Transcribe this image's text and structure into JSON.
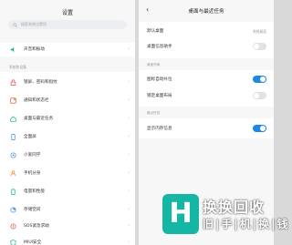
{
  "settings": {
    "title": "设置",
    "search_placeholder": "搜索系统设置项",
    "top_item": "声音和振动",
    "section_label": "系统和设备",
    "items": [
      {
        "label": "锁屏、密码和指纹",
        "icon": "lock-icon",
        "color": "#e25b4f"
      },
      {
        "label": "通知和状态栏",
        "icon": "notification-icon",
        "color": "#e55a3b"
      },
      {
        "label": "桌面与最近任务",
        "icon": "home-icon",
        "color": "#2bb673"
      },
      {
        "label": "全面屏",
        "icon": "fullscreen-icon",
        "color": "#4a90e2"
      },
      {
        "label": "小爱同学",
        "icon": "assistant-icon",
        "color": "#4a90e2"
      },
      {
        "label": "手机分身",
        "icon": "dual-user-icon",
        "color": "#f08a24"
      },
      {
        "label": "电量和性能",
        "icon": "battery-icon",
        "color": "#2bb673"
      },
      {
        "label": "存储空间",
        "icon": "storage-icon",
        "color": "#4a90e2"
      },
      {
        "label": "SOS紧急求助",
        "icon": "sos-icon",
        "color": "#e25b4f"
      },
      {
        "label": "MIUI安全",
        "icon": "shield-icon",
        "color": "#2bb673"
      }
    ]
  },
  "desktop": {
    "title": "桌面与最近任务",
    "rows_top": [
      {
        "label": "默认桌面",
        "value": "系统桌面"
      },
      {
        "label": "桌面信息助手",
        "toggle": false
      }
    ],
    "section1": "桌面布局",
    "rows_mid": [
      {
        "label": "图标自动补位",
        "toggle": true
      },
      {
        "label": "锁定桌面布局",
        "toggle": false
      }
    ],
    "section2": "最近任务",
    "rows_bottom": [
      {
        "label": "显示内存信息",
        "toggle": true
      }
    ]
  },
  "watermark": {
    "brand": "换换回收",
    "sub": "旧|手|机|换|钱"
  },
  "colors": {
    "accent": "#1e88e5",
    "brand": "#16b6a4"
  }
}
